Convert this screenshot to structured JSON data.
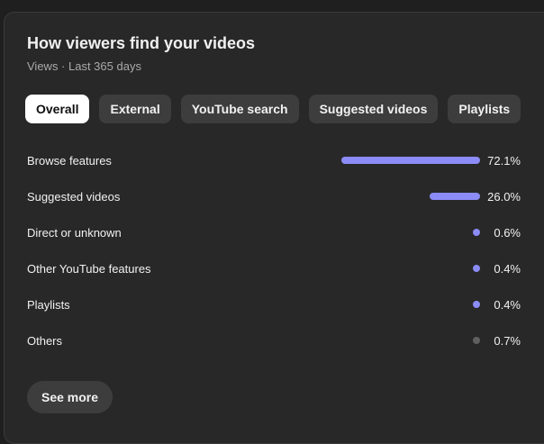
{
  "header": {
    "title": "How viewers find your videos",
    "subtitle": "Views · Last 365 days"
  },
  "tabs": [
    {
      "label": "Overall",
      "active": true
    },
    {
      "label": "External",
      "active": false
    },
    {
      "label": "YouTube search",
      "active": false
    },
    {
      "label": "Suggested videos",
      "active": false
    },
    {
      "label": "Playlists",
      "active": false
    }
  ],
  "colors": {
    "accent_bar": "#8b8cf7",
    "others_bar": "#606060"
  },
  "sources": [
    {
      "label": "Browse features",
      "percent_text": "72.1%",
      "percent": 72.1,
      "color": "#8b8cf7"
    },
    {
      "label": "Suggested videos",
      "percent_text": "26.0%",
      "percent": 26.0,
      "color": "#8b8cf7"
    },
    {
      "label": "Direct or unknown",
      "percent_text": "0.6%",
      "percent": 0.6,
      "color": "#8b8cf7"
    },
    {
      "label": "Other YouTube features",
      "percent_text": "0.4%",
      "percent": 0.4,
      "color": "#8b8cf7"
    },
    {
      "label": "Playlists",
      "percent_text": "0.4%",
      "percent": 0.4,
      "color": "#8b8cf7"
    },
    {
      "label": "Others",
      "percent_text": "0.7%",
      "percent": 0.7,
      "color": "#606060"
    }
  ],
  "footer": {
    "see_more_label": "See more"
  }
}
